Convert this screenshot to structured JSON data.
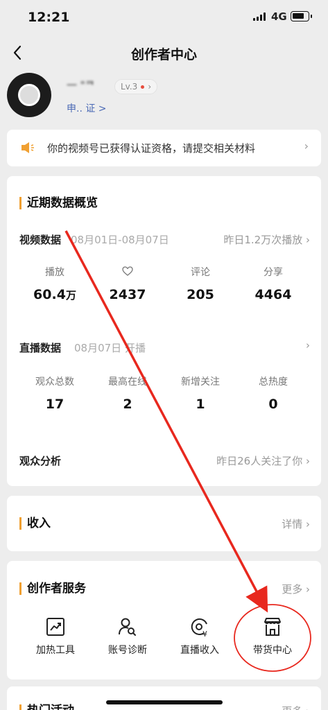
{
  "status_bar": {
    "time": "12:21",
    "network": "4G"
  },
  "nav": {
    "title": "创作者中心"
  },
  "profile": {
    "username": "一 \"ᄏ",
    "level": "Lv.3",
    "verify_text": "申.. 证 >"
  },
  "notice": {
    "text": "你的视频号已获得认证资格，请提交相关材料"
  },
  "overview": {
    "title": "近期数据概览",
    "video": {
      "label": "视频数据",
      "date_range": "08月01日-08月07日",
      "summary": "昨日1.2万次播放",
      "stats": [
        {
          "label": "播放",
          "value": "60.4",
          "unit": "万"
        },
        {
          "label": "",
          "icon": "heart-icon",
          "value": "2437",
          "unit": ""
        },
        {
          "label": "评论",
          "value": "205",
          "unit": ""
        },
        {
          "label": "分享",
          "value": "4464",
          "unit": ""
        }
      ]
    },
    "live": {
      "label": "直播数据",
      "date": "08月07日 开播",
      "stats": [
        {
          "label": "观众总数",
          "value": "17"
        },
        {
          "label": "最高在线",
          "value": "2"
        },
        {
          "label": "新增关注",
          "value": "1"
        },
        {
          "label": "总热度",
          "value": "0"
        }
      ]
    },
    "audience": {
      "label": "观众分析",
      "summary": "昨日26人关注了你"
    }
  },
  "income": {
    "title": "收入",
    "detail": "详情"
  },
  "services": {
    "title": "创作者服务",
    "more": "更多",
    "items": [
      {
        "label": "加热工具",
        "icon": "trend-chart-icon"
      },
      {
        "label": "账号诊断",
        "icon": "user-search-icon"
      },
      {
        "label": "直播收入",
        "icon": "yen-circle-icon"
      },
      {
        "label": "带货中心",
        "icon": "storefront-icon"
      }
    ]
  },
  "activity": {
    "title": "热门活动",
    "more": "更多"
  },
  "colors": {
    "accent": "#f0a032",
    "annotation": "#e8281e",
    "link": "#4a69b5"
  }
}
